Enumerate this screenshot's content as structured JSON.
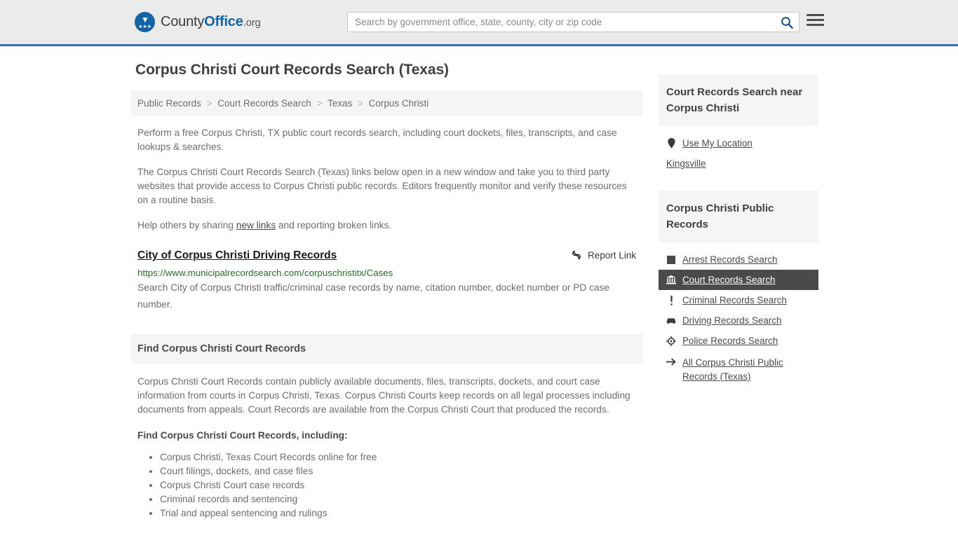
{
  "header": {
    "brand": {
      "county": "County",
      "office": "Office",
      "org": ".org",
      "logo_icon": "eagle-logo-icon"
    },
    "search": {
      "placeholder": "Search by government office, state, county, city or zip code",
      "value": "",
      "search_icon": "search-icon"
    },
    "menu_icon": "hamburger-menu-icon",
    "accent_color": "#3a6ea5",
    "background_color": "#ebebeb"
  },
  "main": {
    "title": "Corpus Christi Court Records Search (Texas)",
    "breadcrumb": [
      "Public Records",
      "Court Records Search",
      "Texas",
      "Corpus Christi"
    ],
    "breadcrumb_separator": ">",
    "intro_paragraph": "Perform a free Corpus Christi, TX public court records search, including court dockets, files, transcripts, and case lookups & searches.",
    "secondary_paragraph": "The Corpus Christi Court Records Search (Texas) links below open in a new window and take you to third party websites that provide access to Corpus Christi public records. Editors frequently monitor and verify these resources on a routine basis.",
    "share_prefix": "Help others by sharing ",
    "share_link": "new links",
    "share_suffix": " and reporting broken links.",
    "result": {
      "title": "City of Corpus Christi Driving Records",
      "url": "https://www.municipalrecordsearch.com/corpuschristitx/Cases",
      "description": "Search City of Corpus Christi traffic/criminal case records by name, citation number, docket number or PD case number.",
      "report_label": "Report Link",
      "report_icon": "broken-link-icon",
      "url_color": "#2a6b2a"
    },
    "section": {
      "heading": "Find Corpus Christi Court Records",
      "paragraph": "Corpus Christi Court Records contain publicly available documents, files, transcripts, dockets, and court case information from courts in Corpus Christi, Texas. Corpus Christi Courts keep records on all legal processes including documents from appeals. Court Records are available from the Corpus Christi Court that produced the records.",
      "list_heading": "Find Corpus Christi Court Records, including:",
      "items": [
        "Corpus Christi, Texas Court Records online for free",
        "Court filings, dockets, and case files",
        "Corpus Christi Court case records",
        "Criminal records and sentencing",
        "Trial and appeal sentencing and rulings"
      ]
    }
  },
  "sidebar": {
    "near_card": {
      "heading": "Court Records Search near Corpus Christi",
      "items": [
        {
          "label": "Use My Location",
          "icon": "map-pin-icon",
          "has_icon": true
        },
        {
          "label": "Kingsville",
          "icon": "",
          "has_icon": false
        }
      ]
    },
    "public_records_card": {
      "heading": "Corpus Christi Public Records",
      "items": [
        {
          "label": "Arrest Records Search",
          "icon": "square-icon",
          "active": false
        },
        {
          "label": "Court Records Search",
          "icon": "courthouse-icon",
          "active": true
        },
        {
          "label": "Criminal Records Search",
          "icon": "exclamation-icon",
          "active": false
        },
        {
          "label": "Driving Records Search",
          "icon": "car-icon",
          "active": false
        },
        {
          "label": "Police Records Search",
          "icon": "badge-icon",
          "active": false
        },
        {
          "label": "All Corpus Christi Public Records (Texas)",
          "icon": "arrow-right-icon",
          "active": false
        }
      ],
      "active_background": "#4a4a4a"
    }
  }
}
